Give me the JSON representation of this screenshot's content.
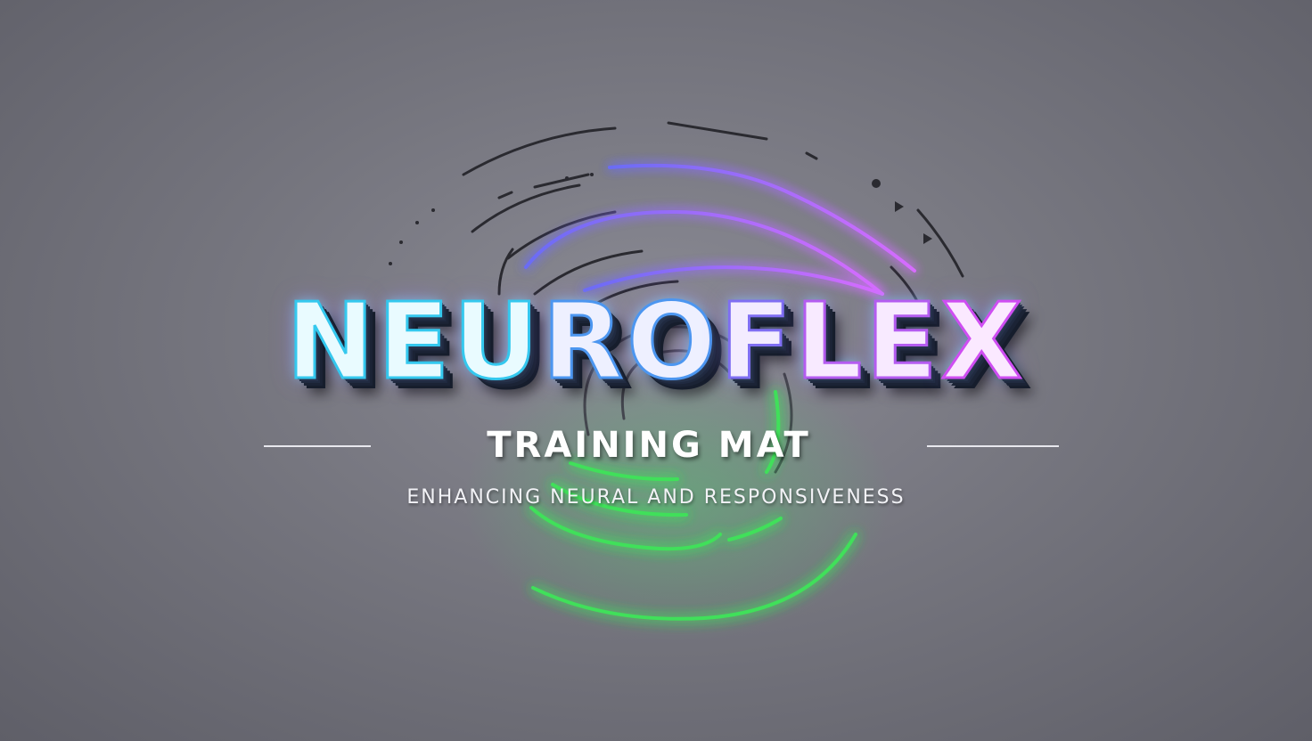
{
  "brand": {
    "part1": "NEU",
    "part2": "RO",
    "part3": "F",
    "part4": "LE",
    "part5": "X"
  },
  "subtitle": "TRAINING MAT",
  "tagline": "ENHANCING NEURAL AND RESPONSIVENESS",
  "colors": {
    "background": "#76767f",
    "cyan_glow": "#34c8ee",
    "violet_glow": "#b45cf0",
    "green_glow": "#3fe05a",
    "dark_arcs": "#2a2a30"
  }
}
